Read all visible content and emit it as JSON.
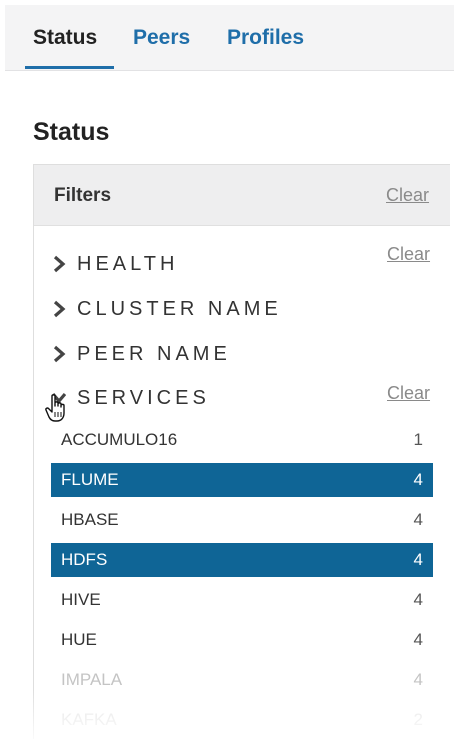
{
  "tabs": {
    "items": [
      {
        "label": "Status",
        "active": true
      },
      {
        "label": "Peers",
        "active": false
      },
      {
        "label": "Profiles",
        "active": false
      }
    ]
  },
  "page": {
    "title": "Status"
  },
  "filters": {
    "title": "Filters",
    "clear_label": "Clear",
    "sections": [
      {
        "label": "HEALTH",
        "expanded": false,
        "clear_label": "Clear"
      },
      {
        "label": "CLUSTER NAME",
        "expanded": false
      },
      {
        "label": "PEER NAME",
        "expanded": false
      },
      {
        "label": "SERVICES",
        "expanded": true,
        "clear_label": "Clear"
      }
    ],
    "services": [
      {
        "name": "ACCUMULO16",
        "count": "1",
        "selected": false
      },
      {
        "name": "FLUME",
        "count": "4",
        "selected": true
      },
      {
        "name": "HBASE",
        "count": "4",
        "selected": false
      },
      {
        "name": "HDFS",
        "count": "4",
        "selected": true
      },
      {
        "name": "HIVE",
        "count": "4",
        "selected": false
      },
      {
        "name": "HUE",
        "count": "4",
        "selected": false
      },
      {
        "name": "IMPALA",
        "count": "4",
        "selected": false
      },
      {
        "name": "KAFKA",
        "count": "2",
        "selected": false
      }
    ]
  },
  "colors": {
    "accent": "#1f6ea9",
    "selected_row": "#0f6596",
    "header_bg": "#eeeeef"
  },
  "icons": {
    "collapsed": "chevron-right-icon",
    "expanded": "chevron-down-icon",
    "cursor": "hand-pointer-icon"
  }
}
